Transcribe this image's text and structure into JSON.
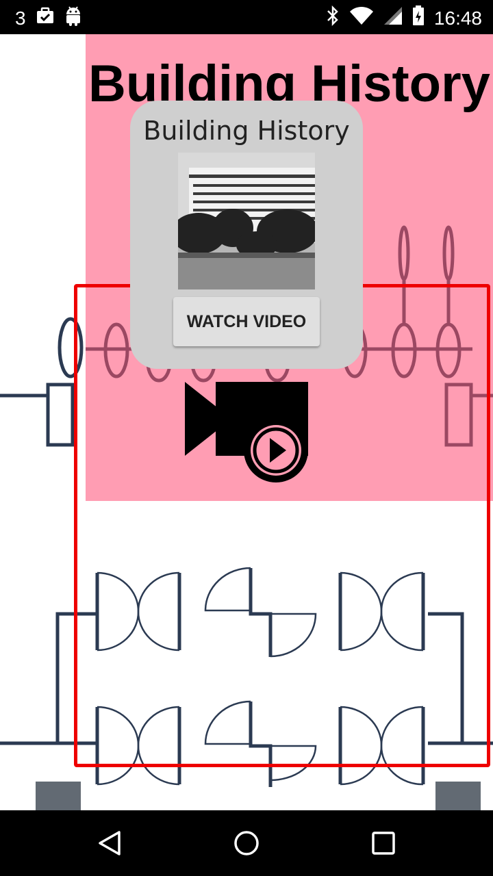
{
  "status_bar": {
    "notification_count": "3",
    "time": "16:48",
    "icons": [
      "briefcase-check-icon",
      "android-icon",
      "bluetooth-icon",
      "wifi-icon",
      "cell-signal-icon",
      "battery-icon"
    ]
  },
  "page": {
    "title": "Building History",
    "background_color": "#ff9db3",
    "highlight_color": "#ee0000"
  },
  "dialog": {
    "title": "Building History",
    "watch_label": "WATCH VIDEO",
    "photo_icon": "building-photo"
  },
  "nav_bar": {
    "icons": [
      "back-icon",
      "home-icon",
      "recents-icon"
    ]
  }
}
